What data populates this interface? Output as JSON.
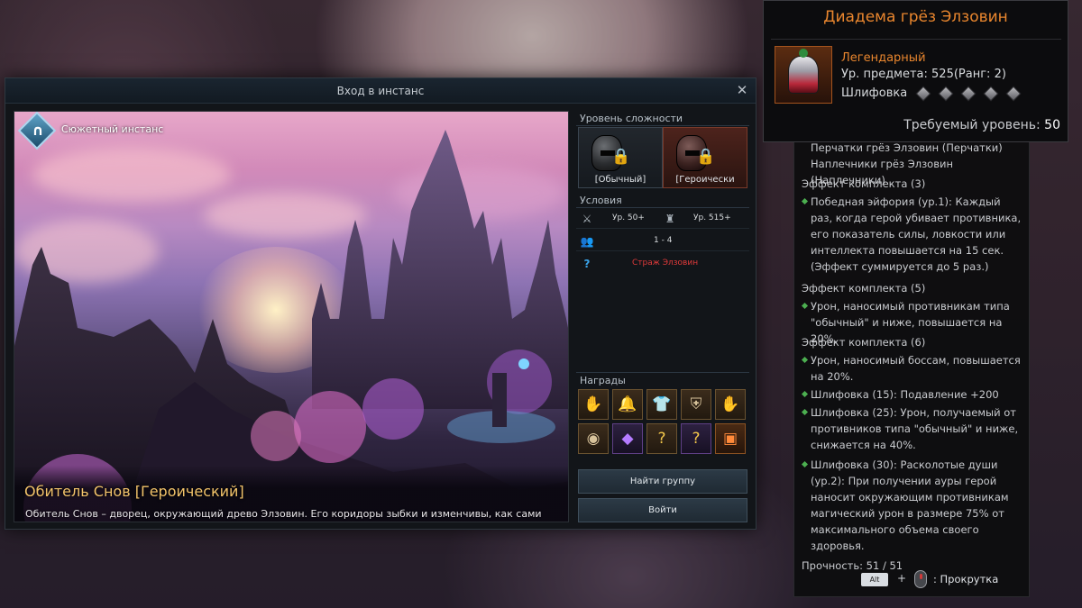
{
  "window": {
    "title": "Вход в инстанс",
    "close_glyph": "✕"
  },
  "scene": {
    "badge_label": "Сюжетный инстанс",
    "dungeon_title": "Обитель Снов [Героический]",
    "dungeon_description": "Обитель Снов – дворец, окружающий древо Элзовин. Его коридоры зыбки и изменчивы, как сами сновидения."
  },
  "difficulty": {
    "label": "Уровень сложности",
    "options": [
      {
        "label": "[Обычный]",
        "icon": "helmet-icon",
        "locked": true
      },
      {
        "label": "[Героически",
        "icon": "helmet-icon",
        "locked": true,
        "selected": true
      }
    ]
  },
  "conditions": {
    "label": "Условия",
    "level_req": "Ур. 50+",
    "item_level_req": "Ур. 515+",
    "party_size": "1 - 4",
    "requirement": "Страж Элзовин",
    "requirement_color": "#e03a3a"
  },
  "rewards": {
    "label": "Награды",
    "items": [
      {
        "icon": "gauntlet-icon",
        "glyph": "✋",
        "tier": "gold"
      },
      {
        "icon": "bell-helmet-icon",
        "glyph": "🔔",
        "tier": "gold"
      },
      {
        "icon": "chest-armor-icon",
        "glyph": "👕",
        "tier": "gold"
      },
      {
        "icon": "shoulder-armor-icon",
        "glyph": "⛨",
        "tier": "gold"
      },
      {
        "icon": "glove-icon",
        "glyph": "✋",
        "tier": "gold"
      },
      {
        "icon": "rune-stone-icon",
        "glyph": "◉",
        "tier": "gold"
      },
      {
        "icon": "purple-crystal-icon",
        "glyph": "◆",
        "tier": "purple"
      },
      {
        "icon": "mystery-box-icon",
        "glyph": "?",
        "tier": "gold"
      },
      {
        "icon": "mystery-bag-icon",
        "glyph": "?",
        "tier": "purple"
      },
      {
        "icon": "treasure-chest-icon",
        "glyph": "▣",
        "tier": "orange"
      }
    ]
  },
  "buttons": {
    "find_group": "Найти группу",
    "enter": "Войти"
  },
  "item_tooltip": {
    "name": "Диадема грёз Элзовин",
    "rarity": "Легендарный",
    "item_level": "Ур. предмета: 525(Ранг: 2)",
    "grinding_label": "Шлифовка",
    "grinding_slots": 5,
    "required_level_label": "Требуемый уровень:",
    "required_level": "50",
    "accent_color": "#e9862e"
  },
  "set_tooltip": {
    "lines": [
      {
        "type": "sub",
        "text": "Перчатки грёз Элзовин (Перчатки)"
      },
      {
        "type": "sub",
        "text": "Наплечники грёз Элзовин (Наплечники)"
      },
      {
        "type": "hdr",
        "text": "Эффект комплекта (3)"
      },
      {
        "type": "bul",
        "text": "Победная эйфория (ур.1): Каждый раз, когда герой убивает противника, его показатель силы, ловкости или интеллекта повышается на 15 сек. (Эффект суммируется до 5 раз.)"
      },
      {
        "type": "hdr",
        "text": "Эффект комплекта (5)"
      },
      {
        "type": "bul",
        "text": "Урон, наносимый противникам типа \"обычный\" и ниже, повышается на 20%."
      },
      {
        "type": "hdr",
        "text": "Эффект комплекта (6)"
      },
      {
        "type": "bul",
        "text": "Урон, наносимый боссам, повышается на 20%."
      },
      {
        "type": "bul",
        "text": "Шлифовка (15): Подавление +200"
      },
      {
        "type": "bul",
        "text": "Шлифовка (25): Урон, получаемый от противников типа \"обычный\" и ниже, снижается на 40%."
      },
      {
        "type": "bul",
        "text": "Шлифовка (30): Расколотые души (ур.2): При получении ауры герой наносит окружающим противникам магический урон в размере 75% от максимального объема своего здоровья."
      }
    ],
    "durability": "Прочность: 51 / 51"
  },
  "scroll_hint": {
    "key": "Alt",
    "plus": "+",
    "text": ": Прокрутка"
  }
}
